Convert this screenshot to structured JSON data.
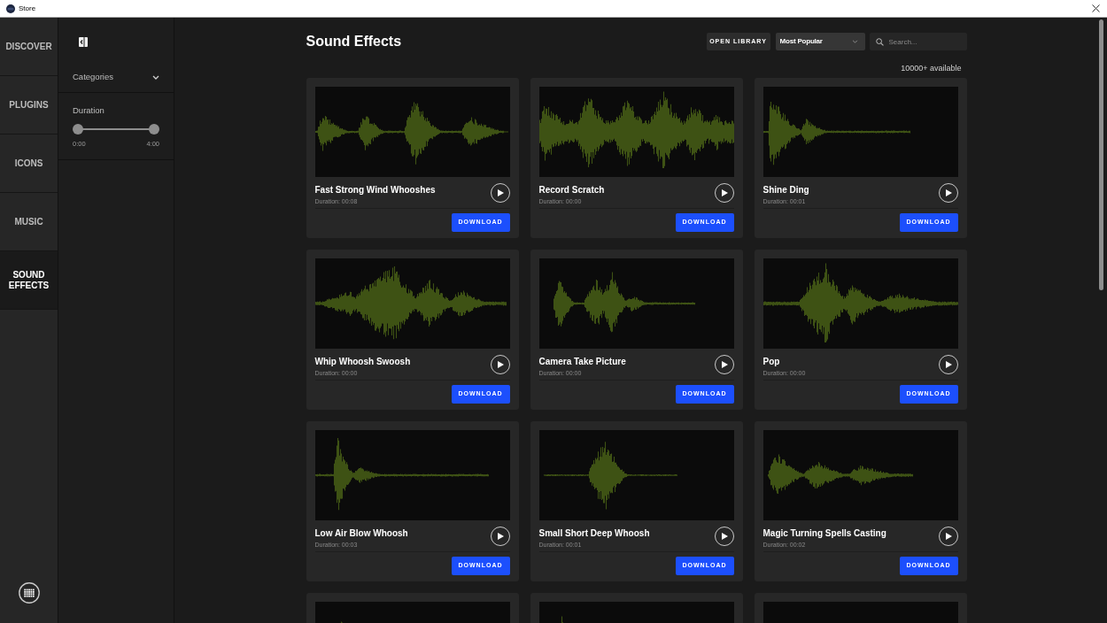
{
  "window": {
    "title": "Store"
  },
  "nav": {
    "items": [
      {
        "label": "DISCOVER",
        "selected": false
      },
      {
        "label": "PLUGINS",
        "selected": false
      },
      {
        "label": "ICONS",
        "selected": false
      },
      {
        "label": "MUSIC",
        "selected": false
      },
      {
        "label": "SOUND EFFECTS",
        "selected": true
      }
    ]
  },
  "filters": {
    "sections": [
      {
        "kind": "dropdown",
        "label": "Categories",
        "expanded": false
      },
      {
        "kind": "range",
        "label": "Duration",
        "low": {
          "level": 0,
          "reading": "0:00"
        },
        "high": {
          "level": 1,
          "reading": "4:00"
        }
      }
    ]
  },
  "page": {
    "title": "Sound Effects",
    "open_library": "OPEN LIBRARY",
    "sort": {
      "value": "Most Popular"
    },
    "search": {
      "placeholder": "Search..."
    },
    "count": "10000+ available"
  },
  "sounds": [
    {
      "kind": "full",
      "title": "Fast Strong Wind Whooshes",
      "duration": "Duration: 00:08",
      "button": "DOWNLOAD"
    },
    {
      "kind": "full",
      "title": "Record Scratch",
      "duration": "Duration: 00:00",
      "button": "DOWNLOAD"
    },
    {
      "kind": "full",
      "title": "Shine Ding",
      "duration": "Duration: 00:01",
      "button": "DOWNLOAD"
    },
    {
      "kind": "full",
      "title": "Whip Whoosh Swoosh",
      "duration": "Duration: 00:00",
      "button": "DOWNLOAD"
    },
    {
      "kind": "full",
      "title": "Camera Take Picture",
      "duration": "Duration: 00:00",
      "button": "DOWNLOAD"
    },
    {
      "kind": "full",
      "title": "Pop",
      "duration": "Duration: 00:00",
      "button": "DOWNLOAD"
    },
    {
      "kind": "full",
      "title": "Low Air Blow Whoosh",
      "duration": "Duration: 00:03",
      "button": "DOWNLOAD"
    },
    {
      "kind": "full",
      "title": "Small Short Deep Whoosh",
      "duration": "Duration: 00:01",
      "button": "DOWNLOAD"
    },
    {
      "kind": "full",
      "title": "Magic Turning Spells Casting",
      "duration": "Duration: 00:02",
      "button": "DOWNLOAD"
    },
    {
      "kind": "cut_off"
    },
    {
      "kind": "cut_off"
    },
    {
      "kind": "cut_off"
    }
  ]
}
